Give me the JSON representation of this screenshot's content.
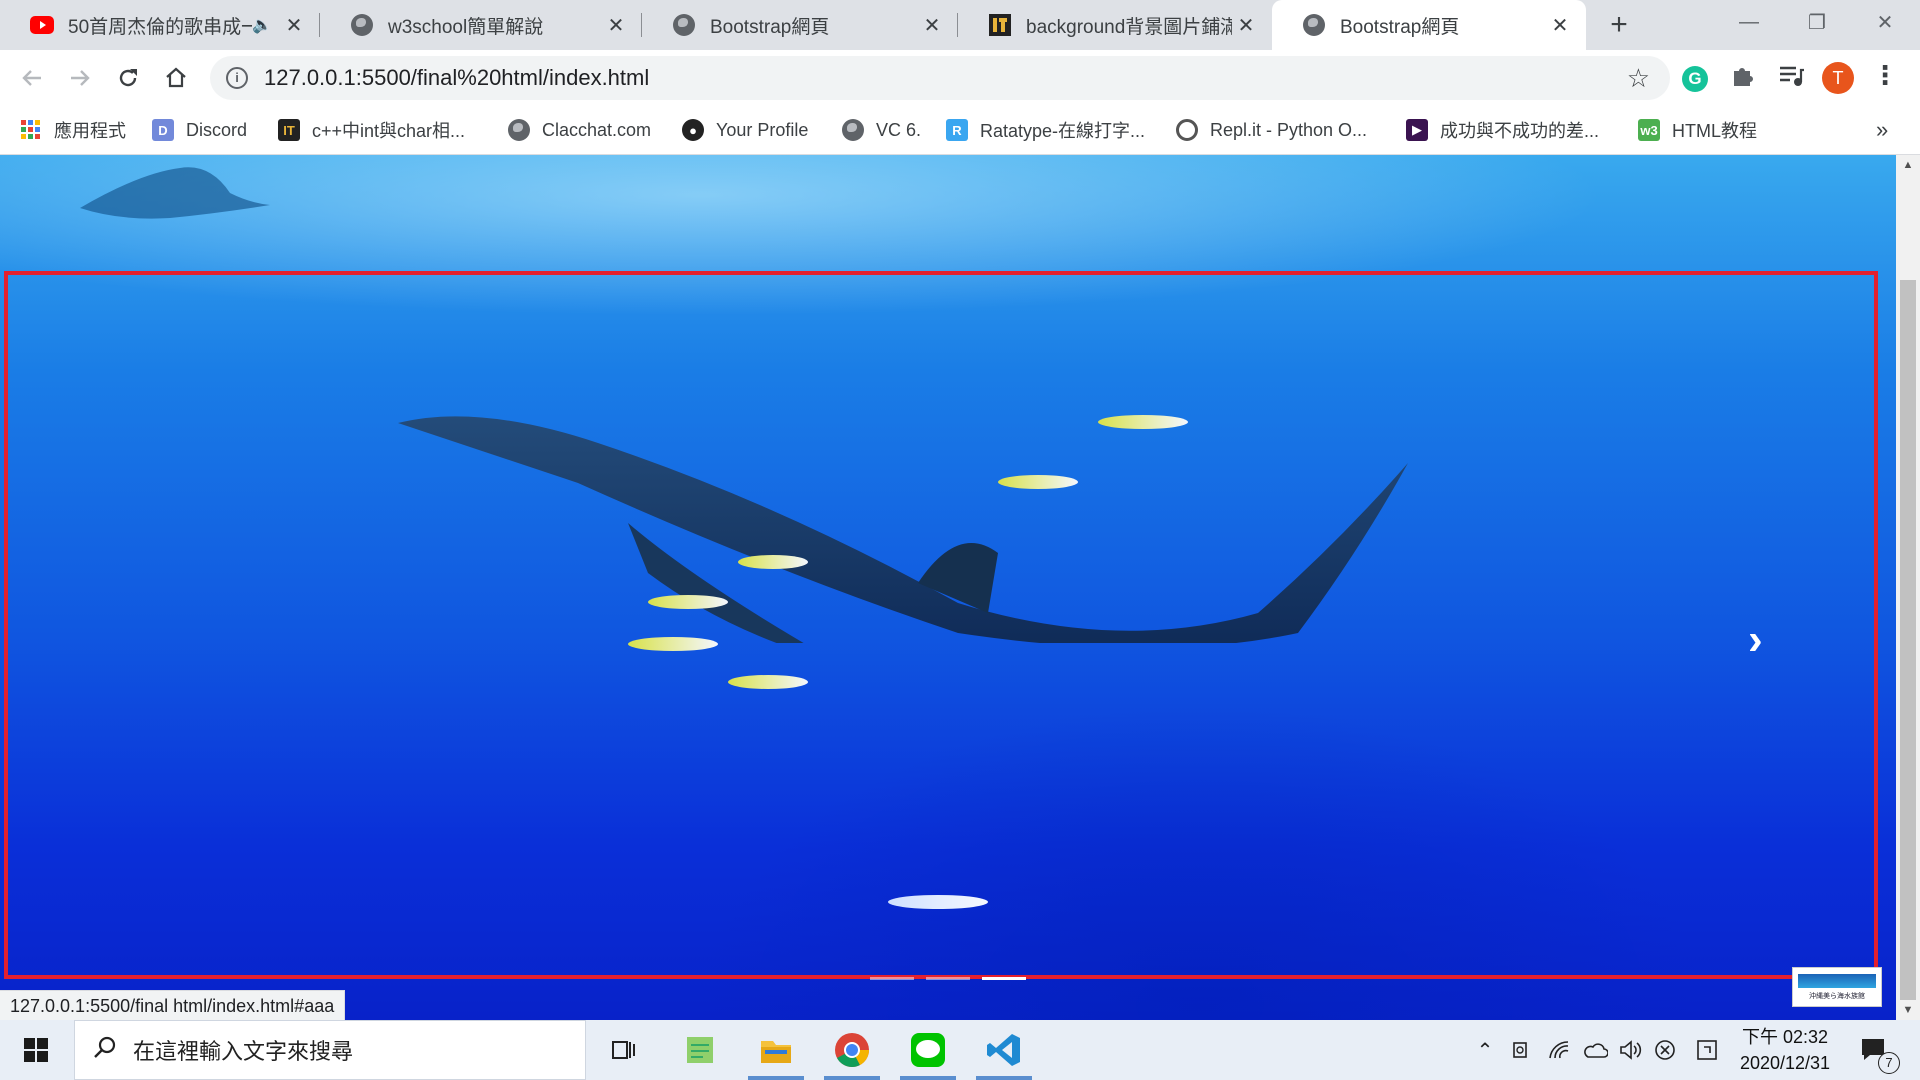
{
  "browser": {
    "tabs": [
      {
        "label": "50首周杰倫的歌串成一",
        "icon": "youtube-icon",
        "audio": true
      },
      {
        "label": "w3school簡單解說",
        "icon": "globe-icon"
      },
      {
        "label": "Bootstrap網頁",
        "icon": "globe-icon"
      },
      {
        "label": "background背景圖片鋪滿",
        "icon": "ithome-icon"
      },
      {
        "label": "Bootstrap網頁",
        "icon": "globe-icon",
        "active": true
      }
    ],
    "new_tab_symbol": "+",
    "window_controls": {
      "minimize": "—",
      "restore": "❐",
      "close": "✕"
    },
    "address": "127.0.0.1:5500/final%20html/index.html",
    "profile_initial": "T",
    "bookmarks": [
      {
        "label": "應用程式",
        "icon": "apps-grid-icon"
      },
      {
        "label": "Discord",
        "icon": "discord-icon"
      },
      {
        "label": "c++中int與char相...",
        "icon": "ithome-icon"
      },
      {
        "label": "Clacchat.com",
        "icon": "globe-icon"
      },
      {
        "label": "Your Profile",
        "icon": "github-icon"
      },
      {
        "label": "VC 6.",
        "icon": "globe-icon"
      },
      {
        "label": "Ratatype-在線打字...",
        "icon": "ratatype-icon"
      },
      {
        "label": "Repl.it - Python O...",
        "icon": "replit-icon"
      },
      {
        "label": "成功與不成功的差...",
        "icon": "play-icon"
      },
      {
        "label": "HTML教程",
        "icon": "w3-icon"
      }
    ],
    "bookmarks_more": "»",
    "status_url": "127.0.0.1:5500/final html/index.html#aaa"
  },
  "page": {
    "carousel": {
      "next_symbol": "›",
      "slide_count": 3,
      "active_slide": 2
    },
    "logo_text": "沖縄美ら海水族館"
  },
  "taskbar": {
    "search_placeholder": "在這裡輸入文字來搜尋",
    "apps": [
      "task-view-icon",
      "notepad-icon",
      "file-explorer-icon",
      "chrome-icon",
      "line-icon",
      "vscode-icon"
    ],
    "time": "下午 02:32",
    "date": "2020/12/31",
    "notification_count": "7"
  },
  "colors": {
    "frame": "#e3202e",
    "accent": "#1a73e8"
  }
}
